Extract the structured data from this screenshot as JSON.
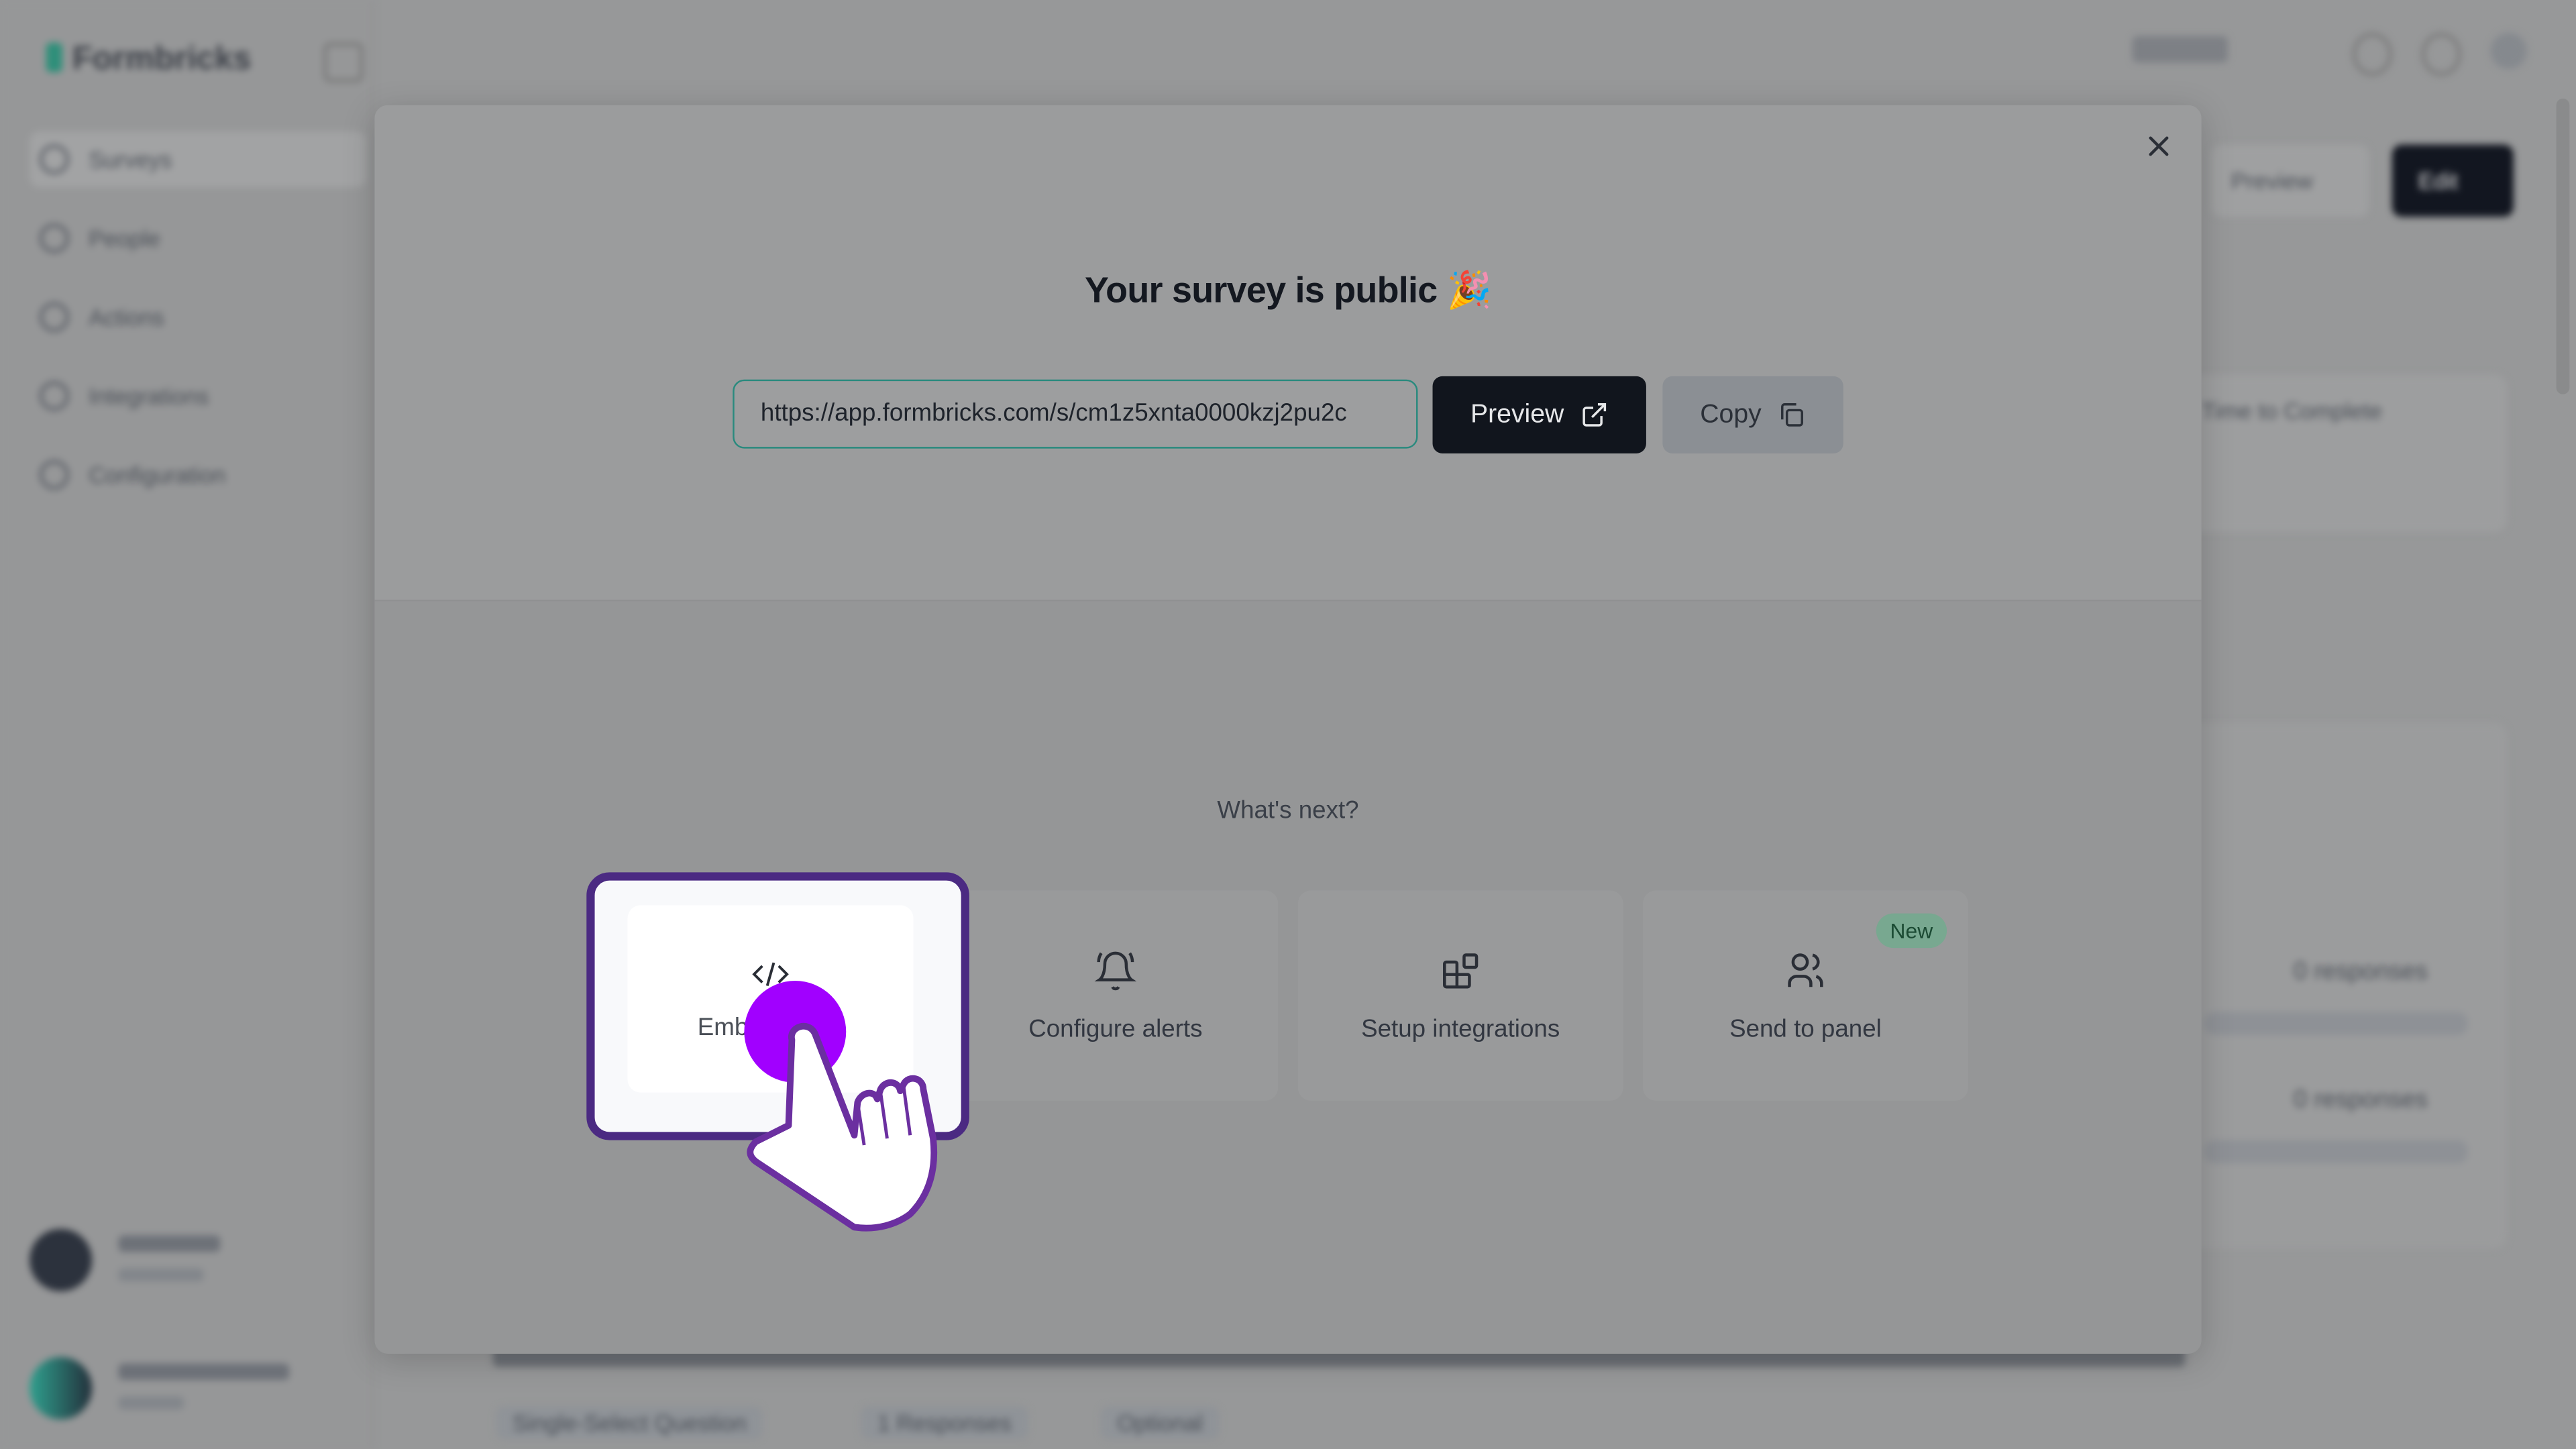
{
  "app": {
    "name": "Formbricks"
  },
  "sidebar": {
    "items": [
      {
        "label": "Surveys"
      },
      {
        "label": "People"
      },
      {
        "label": "Actions"
      },
      {
        "label": "Integrations"
      },
      {
        "label": "Configuration"
      }
    ]
  },
  "background": {
    "preview_label": "Preview",
    "edit_label": "Edit",
    "stat_label": "Time to Complete",
    "responses_1": "0 responses",
    "responses_2": "0 responses",
    "question_type": "Single-Select Question",
    "question_responses": "1 Responses",
    "question_optional": "Optional"
  },
  "modal": {
    "title": "Your survey is public 🎉",
    "url": "https://app.formbricks.com/s/cm1z5xnta0000kzj2pu2c",
    "preview_label": "Preview",
    "copy_label": "Copy",
    "whats_next": "What's next?",
    "cards": [
      {
        "label": "Emb",
        "icon": "code-icon"
      },
      {
        "label": "Configure alerts",
        "icon": "bell-icon"
      },
      {
        "label": "Setup integrations",
        "icon": "blocks-icon"
      },
      {
        "label": "Send to panel",
        "icon": "users-icon",
        "badge": "New"
      }
    ]
  },
  "colors": {
    "accent": "#2a8a7e",
    "primary": "#11151d",
    "highlight": "#4b2a82",
    "tap": "#a100ff"
  }
}
